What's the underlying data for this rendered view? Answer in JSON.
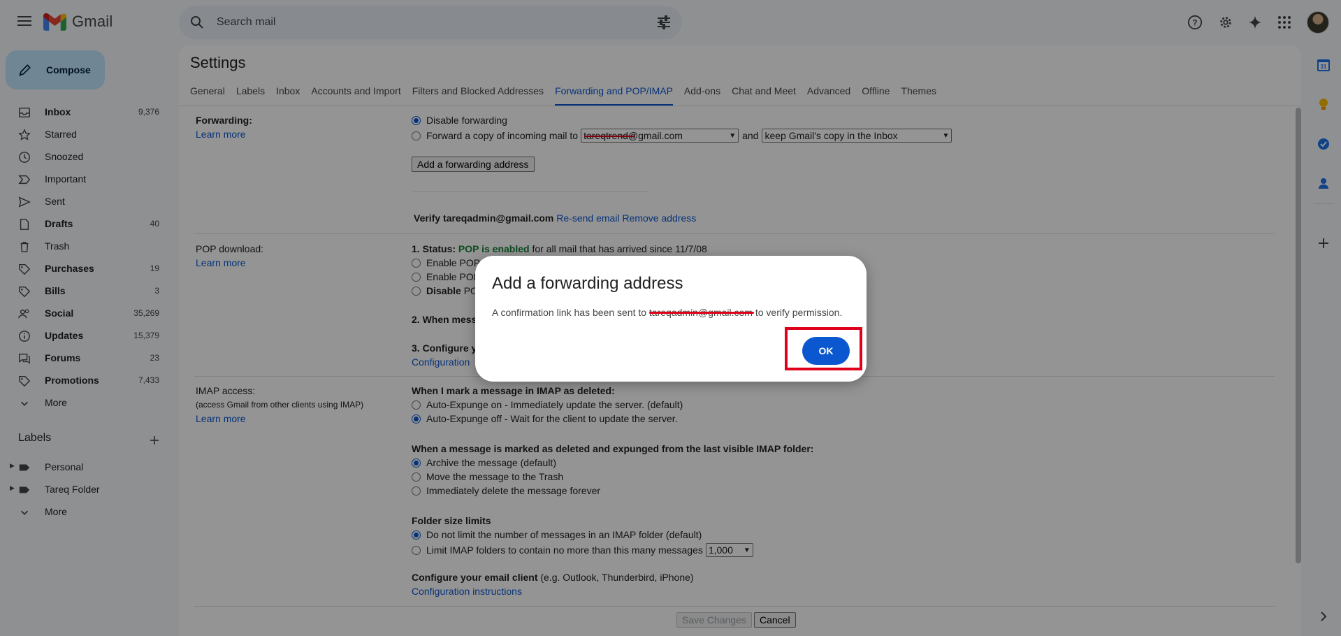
{
  "app": {
    "name": "Gmail"
  },
  "search": {
    "placeholder": "Search mail"
  },
  "compose": {
    "label": "Compose"
  },
  "nav": [
    {
      "label": "Inbox",
      "count": "9,376",
      "bold": true,
      "icon": "inbox-icon"
    },
    {
      "label": "Starred",
      "count": "",
      "bold": false,
      "icon": "star-icon"
    },
    {
      "label": "Snoozed",
      "count": "",
      "bold": false,
      "icon": "clock-icon"
    },
    {
      "label": "Important",
      "count": "",
      "bold": false,
      "icon": "important-icon"
    },
    {
      "label": "Sent",
      "count": "",
      "bold": false,
      "icon": "send-icon"
    },
    {
      "label": "Drafts",
      "count": "40",
      "bold": true,
      "icon": "draft-icon"
    },
    {
      "label": "Trash",
      "count": "",
      "bold": false,
      "icon": "trash-icon"
    },
    {
      "label": "Purchases",
      "count": "19",
      "bold": true,
      "icon": "tag-icon"
    },
    {
      "label": "Bills",
      "count": "3",
      "bold": true,
      "icon": "tag-icon"
    },
    {
      "label": "Social",
      "count": "35,269",
      "bold": true,
      "icon": "people-icon"
    },
    {
      "label": "Updates",
      "count": "15,379",
      "bold": true,
      "icon": "info-icon"
    },
    {
      "label": "Forums",
      "count": "23",
      "bold": true,
      "icon": "forum-icon"
    },
    {
      "label": "Promotions",
      "count": "7,433",
      "bold": true,
      "icon": "tag-icon"
    },
    {
      "label": "More",
      "count": "",
      "bold": false,
      "icon": "chevron-down-icon"
    }
  ],
  "labels": {
    "heading": "Labels",
    "items": [
      {
        "label": "Personal"
      },
      {
        "label": "Tareq Folder"
      },
      {
        "label": "More"
      }
    ]
  },
  "settings": {
    "title": "Settings",
    "tabs": [
      "General",
      "Labels",
      "Inbox",
      "Accounts and Import",
      "Filters and Blocked Addresses",
      "Forwarding and POP/IMAP",
      "Add-ons",
      "Chat and Meet",
      "Advanced",
      "Offline",
      "Themes"
    ],
    "active_tab": "Forwarding and POP/IMAP",
    "forwarding": {
      "title": "Forwarding:",
      "learn_more": "Learn more",
      "disable": "Disable forwarding",
      "forward_copy": "Forward a copy of incoming mail to",
      "address_value": "tareqtrend@gmail.com",
      "and": "and",
      "keep_option": "keep Gmail's copy in the Inbox",
      "add_button": "Add a forwarding address",
      "verify_label": "Verify tareqadmin@gmail.com",
      "resend": "Re-send email",
      "remove": "Remove address"
    },
    "pop": {
      "title": "POP download:",
      "learn_more": "Learn more",
      "status_prefix": "1. Status:",
      "status_value": "POP is enabled",
      "status_suffix": "for all mail that has arrived since 11/7/08",
      "opt1": "Enable POP",
      "opt2": "Enable POP",
      "opt3_bold": "Disable",
      "opt3_rest": "PO",
      "when_label": "2. When mess",
      "configure_label": "3. Configure y",
      "config_link": "Configuration"
    },
    "imap": {
      "title": "IMAP access:",
      "subtitle": "(access Gmail from other clients using IMAP)",
      "learn_more": "Learn more",
      "deleted_heading": "When I mark a message in IMAP as deleted:",
      "expunge_on": "Auto-Expunge on - Immediately update the server. (default)",
      "expunge_off": "Auto-Expunge off - Wait for the client to update the server.",
      "expunged_heading": "When a message is marked as deleted and expunged from the last visible IMAP folder:",
      "archive": "Archive the message (default)",
      "move_trash": "Move the message to the Trash",
      "delete_forever": "Immediately delete the message forever",
      "folder_heading": "Folder size limits",
      "no_limit": "Do not limit the number of messages in an IMAP folder (default)",
      "limit": "Limit IMAP folders to contain no more than this many messages",
      "limit_value": "1,000",
      "client_heading": "Configure your email client",
      "client_hint": "(e.g. Outlook, Thunderbird, iPhone)",
      "config_link": "Configuration instructions"
    },
    "save_button": "Save Changes",
    "cancel_button": "Cancel"
  },
  "dialog": {
    "title": "Add a forwarding address",
    "message_prefix": "A confirmation link has been sent to",
    "message_email": "tareqadmin@gmail.com",
    "message_suffix": "to verify permission.",
    "ok": "OK"
  },
  "colors": {
    "accent": "#0b57d0",
    "compose_bg": "#c2e7ff",
    "status_green": "#188038",
    "highlight_red": "#e0001b"
  }
}
